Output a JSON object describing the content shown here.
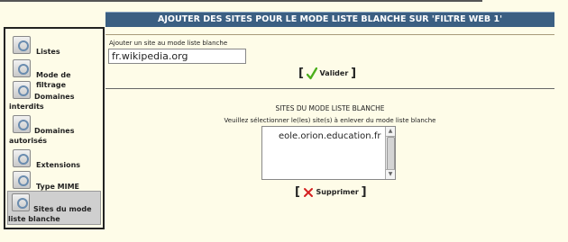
{
  "header": {
    "title": "AJOUTER DES SITES POUR LE MODE LISTE BLANCHE SUR 'FILTRE WEB 1'"
  },
  "sidebar": {
    "items": [
      {
        "label": "Listes",
        "icon": "list-icon",
        "active": false
      },
      {
        "label": "Mode de filtrage",
        "icon": "filter-icon",
        "active": false
      },
      {
        "label": "Domaines interdits",
        "icon": "forbidden-icon",
        "active": false
      },
      {
        "label": "Domaines autorisés",
        "icon": "allowed-icon",
        "active": false
      },
      {
        "label": "Extensions",
        "icon": "extension-icon",
        "active": false
      },
      {
        "label": "Type MIME",
        "icon": "mime-icon",
        "active": false
      },
      {
        "label": "Sites du mode liste blanche",
        "icon": "whitelist-icon",
        "active": true
      }
    ]
  },
  "form": {
    "input_label": "Ajouter un site au mode liste blanche",
    "input_value": "fr.wikipedia.org",
    "submit_label": "Valider"
  },
  "whitelist": {
    "title": "SITES DU MODE LISTE BLANCHE",
    "instruction": "Veuillez sélectionner le(les) site(s) à enlever du mode liste blanche",
    "sites": [
      "eole.orion.education.fr"
    ],
    "delete_label": "Supprimer"
  },
  "colors": {
    "banner": "#3b5f82",
    "background": "#fefce8",
    "check": "#4caf1c",
    "cross": "#d42020"
  }
}
